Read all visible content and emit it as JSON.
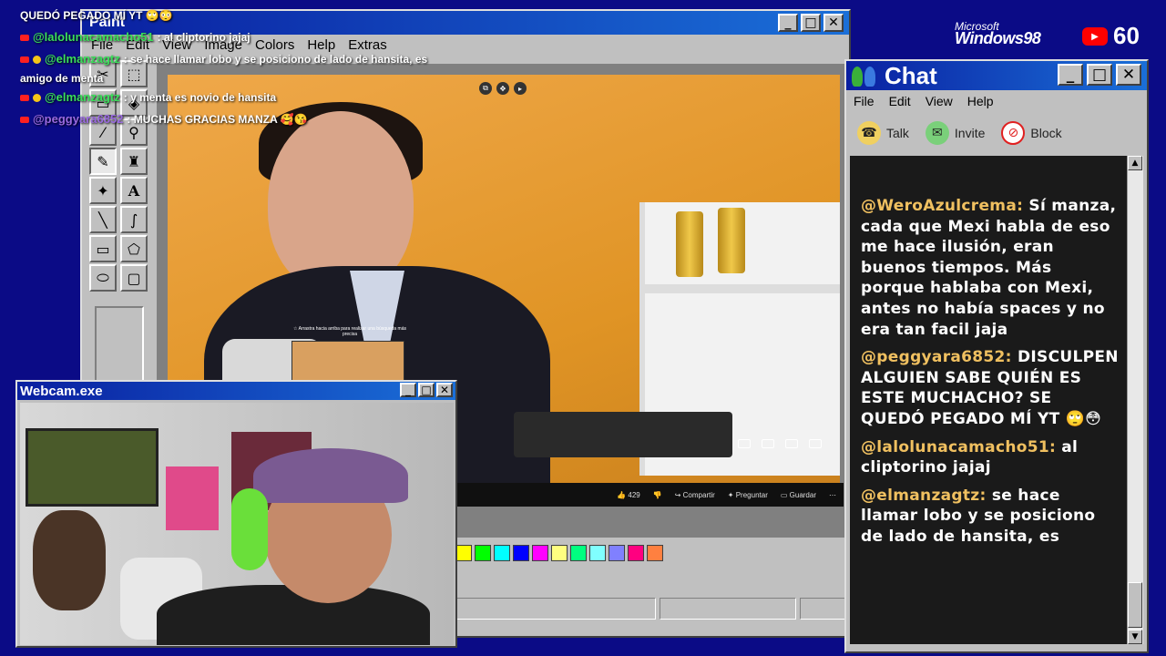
{
  "overlay_chat": {
    "lines": [
      {
        "text": "QUEDÓ PEGADO MÍ YT 🙄😳"
      },
      {
        "user": "@lalolunacamacho51",
        "user_color": "#3adf5a",
        "text": ": al cliptorino jajaj"
      },
      {
        "user": "@elmanzagtz",
        "user_color": "#3adf5a",
        "text": ": se hace llamar lobo y se posiciono de lado de hansita, es"
      },
      {
        "text": "amigo de menta"
      },
      {
        "user": "@elmanzagtz",
        "user_color": "#3adf5a",
        "text": ": y menta es novio de hansita"
      },
      {
        "user": "@peggyara6852",
        "user_color": "#9a6ae0",
        "text": ": MUCHAS GRACIAS MANZA 🥰😘"
      }
    ]
  },
  "brand": {
    "microsoft": "Microsoft",
    "windows": "Windows98",
    "viewer_count": "60"
  },
  "paint": {
    "title": "Paint",
    "menu": [
      "File",
      "Edit",
      "View",
      "Image",
      "Colors",
      "Help",
      "Extras"
    ],
    "palette": [
      "#ffff00",
      "#00ff00",
      "#00ffff",
      "#0000ff",
      "#ff00ff",
      "#ffff80",
      "#00ff80",
      "#80ffff",
      "#8080ff",
      "#ff0080",
      "#ff8040"
    ],
    "video": {
      "hint": "☆ Arrastra hacia arriba para realizar una búsqueda más precisa",
      "likes": "429",
      "share": "Compartir",
      "ask": "Preguntar",
      "save": "Guardar"
    }
  },
  "webcam": {
    "title": "Webcam.exe"
  },
  "chat": {
    "title": "Chat",
    "menu": [
      "File",
      "Edit",
      "View",
      "Help"
    ],
    "tools": [
      "Talk",
      "Invite",
      "Block"
    ],
    "messages": [
      {
        "user": "@WeroAzulcrema:",
        "text": "Sí manza, cada que Mexi habla de eso me hace ilusión, eran buenos tiempos. Más porque hablaba con Mexi, antes no había spaces y no era tan facil jaja"
      },
      {
        "user": "@peggyara6852:",
        "text": "DISCULPEN ALGUIEN SABE QUIÉN ES ESTE MUCHACHO? SE QUEDÓ PEGADO MÍ YT 🙄😳"
      },
      {
        "user": "@lalolunacamacho51:",
        "text": "al cliptorino jajaj"
      },
      {
        "user": "@elmanzagtz:",
        "text": "se hace llamar lobo y se posiciono de lado de hansita, es"
      }
    ]
  }
}
